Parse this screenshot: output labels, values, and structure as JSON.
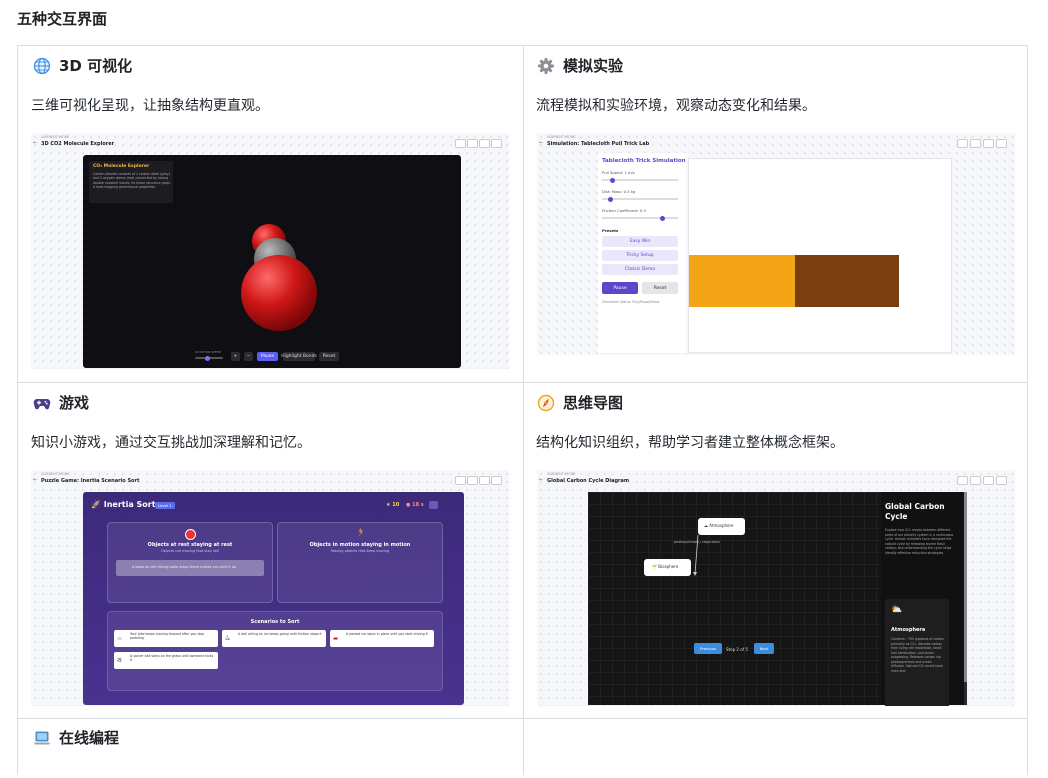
{
  "page": {
    "title": "五种交互界面"
  },
  "cards": [
    {
      "title": "3D 可视化",
      "icon": "globe-icon",
      "description": "三维可视化呈现，让抽象结构更直观。",
      "screenshot": {
        "breadcrumb": "CURRENT MODE",
        "title": "3D CO2 Molecule Explorer",
        "panel_title": "CO₂ Molecule Explorer",
        "panel_text": "Carbon dioxide consists of 1 carbon atom (gray) and 2 oxygen atoms (red) connected by strong double covalent bonds. Its linear structure gives it heat-trapping greenhouse properties.",
        "slider_label": "ROTATION SPEED",
        "buttons": [
          "+",
          "−",
          "Pause",
          "Highlight Bonds",
          "Reset"
        ]
      }
    },
    {
      "title": "模拟实验",
      "icon": "gear-icon",
      "description": "流程模拟和实验环境，观察动态变化和结果。",
      "screenshot": {
        "breadcrumb": "CURRENT MODE",
        "title": "Simulation: Tablecloth Pull Trick Lab",
        "panel_title": "Tablecloth Trick Simulation",
        "controls": [
          "Pull Speed: 1 m/s",
          "Dish Mass: 0.5 kg",
          "Friction Coefficient: 0.3"
        ],
        "presets_label": "Presets",
        "presets": [
          "Easy Win",
          "Tricky Setup",
          "Classic Demo"
        ],
        "buttons": [
          "Pause",
          "Reset"
        ],
        "status": "Simulation Status: Play/Pause/Reset"
      }
    },
    {
      "title": "游戏",
      "icon": "gamepad-icon",
      "description": "知识小游戏，通过交互挑战加深理解和记忆。",
      "screenshot": {
        "breadcrumb": "CURRENT MODE",
        "title": "Puzzle Game: Inertia Scenario Sort",
        "game_title": "Inertia Sort",
        "level": "Level 1",
        "score": "10",
        "timer": "18 s",
        "col1_title": "Objects at rest staying at rest",
        "col1_sub": "Objects not moving that stay still",
        "col1_item": "A book on the dining table stays there unless you pick it up",
        "col2_title": "Objects in motion staying in motion",
        "col2_sub": "Moving objects that keep moving",
        "sort_title": "Scenarios to Sort",
        "scenarios": [
          "Your bike keeps moving forward after you stop pedaling",
          "A ball rolling on ice keeps going until friction stops it",
          "A parked car stays in place until you start driving it",
          "A soccer ball stays on the grass until someone kicks it"
        ]
      }
    },
    {
      "title": "思维导图",
      "icon": "compass-icon",
      "description": "结构化知识组织，帮助学习者建立整体概念框架。",
      "screenshot": {
        "breadcrumb": "CURRENT MODE",
        "title": "Global Carbon Cycle Diagram",
        "node_atmosphere": "Atmosphere",
        "node_biosphere": "Biosphere",
        "edge_label": "photosynthesis / respiration",
        "side_title": "Global Carbon Cycle",
        "side_text": "Explore how CO₂ moves between different parts of our planet's system in a continuous cycle. Human activities have disrupted the natural cycle by releasing stored fossil carbon, and understanding the cycle helps identify effective reduction strategies.",
        "card_title": "Atmosphere",
        "card_text": "Contains ~750 gigatons of carbon, primarily as CO₂. Absorbs carbon from living cell respiration, fossil fuel combustion, and ocean outgassing. Releases carbon via photosynthesis and ocean diffusion. Natural CO₂ levels have risen and",
        "prev": "Previous",
        "step": "Step 2 of 5",
        "next": "Next"
      }
    },
    {
      "title": "在线编程",
      "icon": "laptop-icon",
      "description": ""
    }
  ]
}
